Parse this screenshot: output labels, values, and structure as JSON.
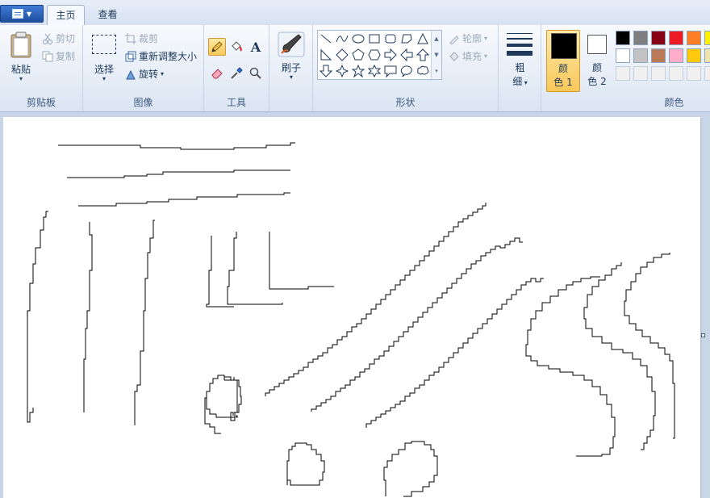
{
  "app_menu": {
    "icon": "document-menu-icon"
  },
  "tabs": [
    {
      "label": "主页",
      "active": true
    },
    {
      "label": "查看",
      "active": false
    }
  ],
  "groups": {
    "clipboard": {
      "label": "剪贴板",
      "paste": "粘贴",
      "cut": "剪切",
      "copy": "复制"
    },
    "image": {
      "label": "图像",
      "select": "选择",
      "crop": "裁剪",
      "resize": "重新调整大小",
      "rotate": "旋转"
    },
    "tools": {
      "label": "工具",
      "items": [
        "pencil-icon",
        "fill-bucket-icon",
        "text-icon",
        "eraser-icon",
        "color-picker-icon",
        "magnifier-icon"
      ]
    },
    "brushes": {
      "label": "刷子"
    },
    "shapes": {
      "label": "形状",
      "outline": "轮廓",
      "fill": "填充"
    },
    "size": {
      "label_top": "粗",
      "label_bottom": "细"
    },
    "colors": {
      "label": "颜色",
      "color1_top": "颜",
      "color1_bottom": "色 1",
      "color2_top": "颜",
      "color2_bottom": "色 2",
      "color1_value": "#000000",
      "color2_value": "#ffffff",
      "palette_row1": [
        "#000000",
        "#7f7f7f",
        "#880015",
        "#ed1c24",
        "#ff7f27",
        "#fff200"
      ],
      "palette_row2": [
        "#ffffff",
        "#c3c3c3",
        "#b97a57",
        "#ffaec9",
        "#ffc90e",
        "#efe4b0"
      ],
      "palette_row3": [
        "#f0f0f0",
        "#f0f0f0",
        "#f0f0f0",
        "#f0f0f0",
        "#f0f0f0",
        "#f0f0f0"
      ]
    }
  }
}
